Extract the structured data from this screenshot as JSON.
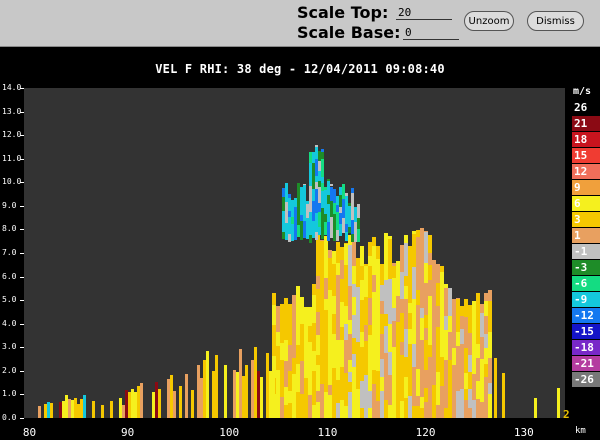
{
  "toolbar": {
    "scale_top_label": "Scale Top:",
    "scale_top_value": "20",
    "scale_base_label": "Scale Base:",
    "scale_base_value": "0",
    "unzoom_label": "Unzoom",
    "dismiss_label": "Dismiss"
  },
  "plot": {
    "title": "VEL F  RHI: 38 deg  -  12/04/2011 09:08:40",
    "y_ticks": [
      "0.0",
      "1.0",
      "2.0",
      "3.0",
      "4.0",
      "5.0",
      "6.0",
      "7.0",
      "8.0",
      "9.0",
      "10.0",
      "11.0",
      "12.0",
      "13.0",
      "14.0"
    ],
    "x_ticks": [
      "80",
      "90",
      "100",
      "110",
      "120",
      "130"
    ],
    "x_unit": "km",
    "corner_mark": "2",
    "background_color": "#333333"
  },
  "legend": {
    "unit": "m/s",
    "items": [
      {
        "label": "26",
        "color": "#000000"
      },
      {
        "label": "21",
        "color": "#8b0a14"
      },
      {
        "label": "18",
        "color": "#c8141e"
      },
      {
        "label": "15",
        "color": "#f03c32"
      },
      {
        "label": "12",
        "color": "#f06e5a"
      },
      {
        "label": "9",
        "color": "#f0a03c"
      },
      {
        "label": "6",
        "color": "#f5f01e"
      },
      {
        "label": "3",
        "color": "#f5c800"
      },
      {
        "label": "1",
        "color": "#e8a060"
      },
      {
        "label": "-1",
        "color": "#c0c0c0"
      },
      {
        "label": "-3",
        "color": "#1e8c28"
      },
      {
        "label": "-6",
        "color": "#14dc82"
      },
      {
        "label": "-9",
        "color": "#14c8dc"
      },
      {
        "label": "-12",
        "color": "#1478f0"
      },
      {
        "label": "-15",
        "color": "#1414c8"
      },
      {
        "label": "-18",
        "color": "#7828c8"
      },
      {
        "label": "-21",
        "color": "#b43ca0"
      },
      {
        "label": "-26",
        "color": "#787878"
      }
    ]
  }
}
